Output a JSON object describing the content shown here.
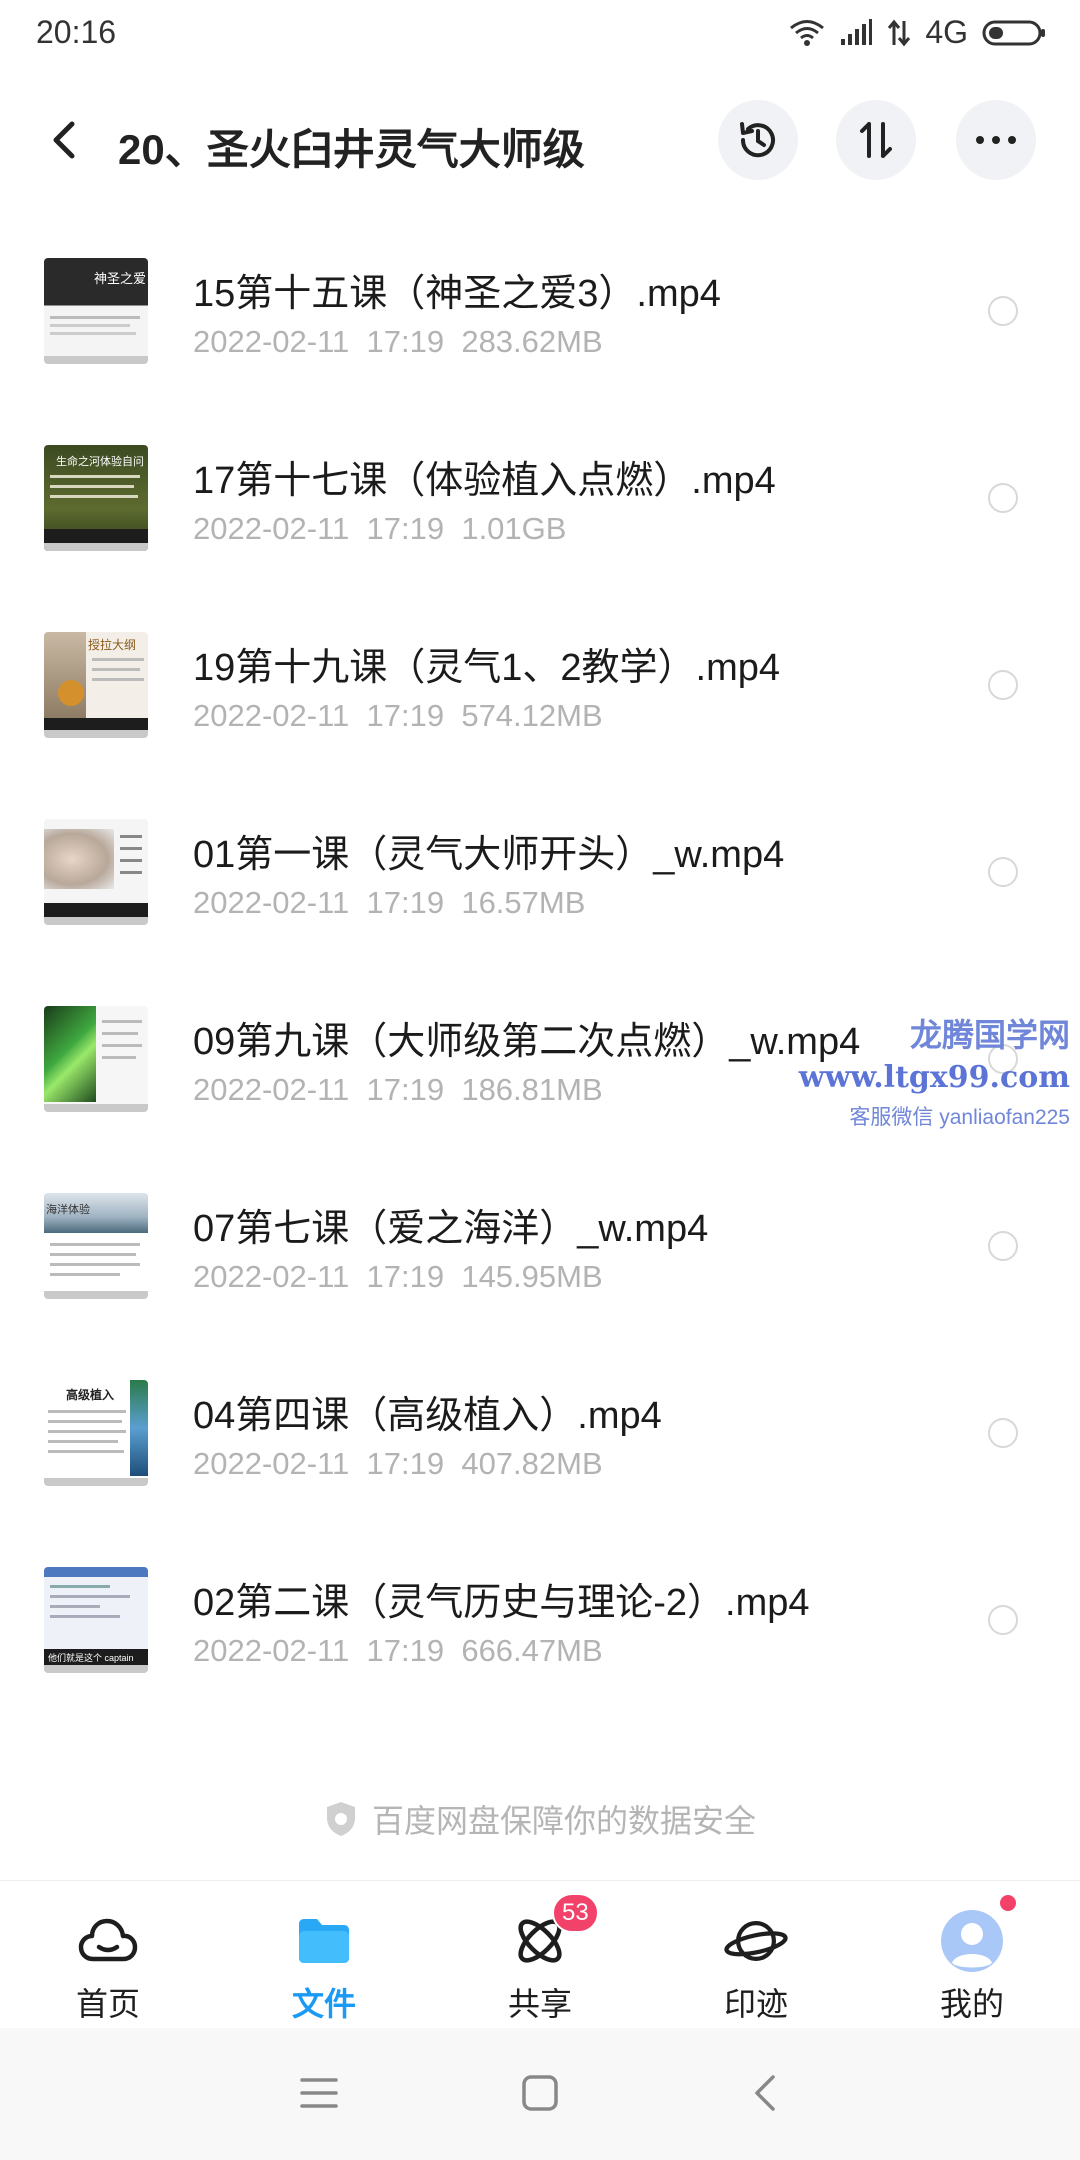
{
  "status_bar": {
    "time": "20:16",
    "network": "4G"
  },
  "header": {
    "title": "20、圣火臼井灵气大师级"
  },
  "files": [
    {
      "name": "15第十五课（神圣之爱3）.mp4",
      "date": "2022-02-11",
      "time": "17:19",
      "size": "283.62MB",
      "thumb_text": "神圣之爱"
    },
    {
      "name": "17第十七课（体验植入点燃）.mp4",
      "date": "2022-02-11",
      "time": "17:19",
      "size": "1.01GB",
      "thumb_text": "生命之河体验自问"
    },
    {
      "name": "19第十九课（灵气1、2教学）.mp4",
      "date": "2022-02-11",
      "time": "17:19",
      "size": "574.12MB",
      "thumb_text": "授拉大纲"
    },
    {
      "name": "01第一课（灵气大师开头）_w.mp4",
      "date": "2022-02-11",
      "time": "17:19",
      "size": "16.57MB",
      "thumb_text": ""
    },
    {
      "name": "09第九课（大师级第二次点燃）_w.mp4",
      "date": "2022-02-11",
      "time": "17:19",
      "size": "186.81MB",
      "thumb_text": ""
    },
    {
      "name": "07第七课（爱之海洋）_w.mp4",
      "date": "2022-02-11",
      "time": "17:19",
      "size": "145.95MB",
      "thumb_text": "海洋体验"
    },
    {
      "name": "04第四课（高级植入）.mp4",
      "date": "2022-02-11",
      "time": "17:19",
      "size": "407.82MB",
      "thumb_text": "高级植入"
    },
    {
      "name": "02第二课（灵气历史与理论-2）.mp4",
      "date": "2022-02-11",
      "time": "17:19",
      "size": "666.47MB",
      "thumb_text": "他们就是这个 captain"
    }
  ],
  "watermark": {
    "line1": "龙腾国学网",
    "line2": "www.ltgx99.com",
    "line3": "客服微信 yanliaofan225"
  },
  "footer_note": "百度网盘保障你的数据安全",
  "nav": {
    "items": [
      {
        "label": "首页",
        "icon": "cloud-icon"
      },
      {
        "label": "文件",
        "icon": "folder-icon",
        "active": true
      },
      {
        "label": "共享",
        "icon": "share-atom-icon",
        "badge": "53"
      },
      {
        "label": "印迹",
        "icon": "planet-icon"
      },
      {
        "label": "我的",
        "icon": "avatar-icon",
        "dot": true
      }
    ]
  },
  "colors": {
    "accent": "#1a9af5",
    "badge": "#f2426a",
    "meta_text": "#b3b3b3"
  }
}
